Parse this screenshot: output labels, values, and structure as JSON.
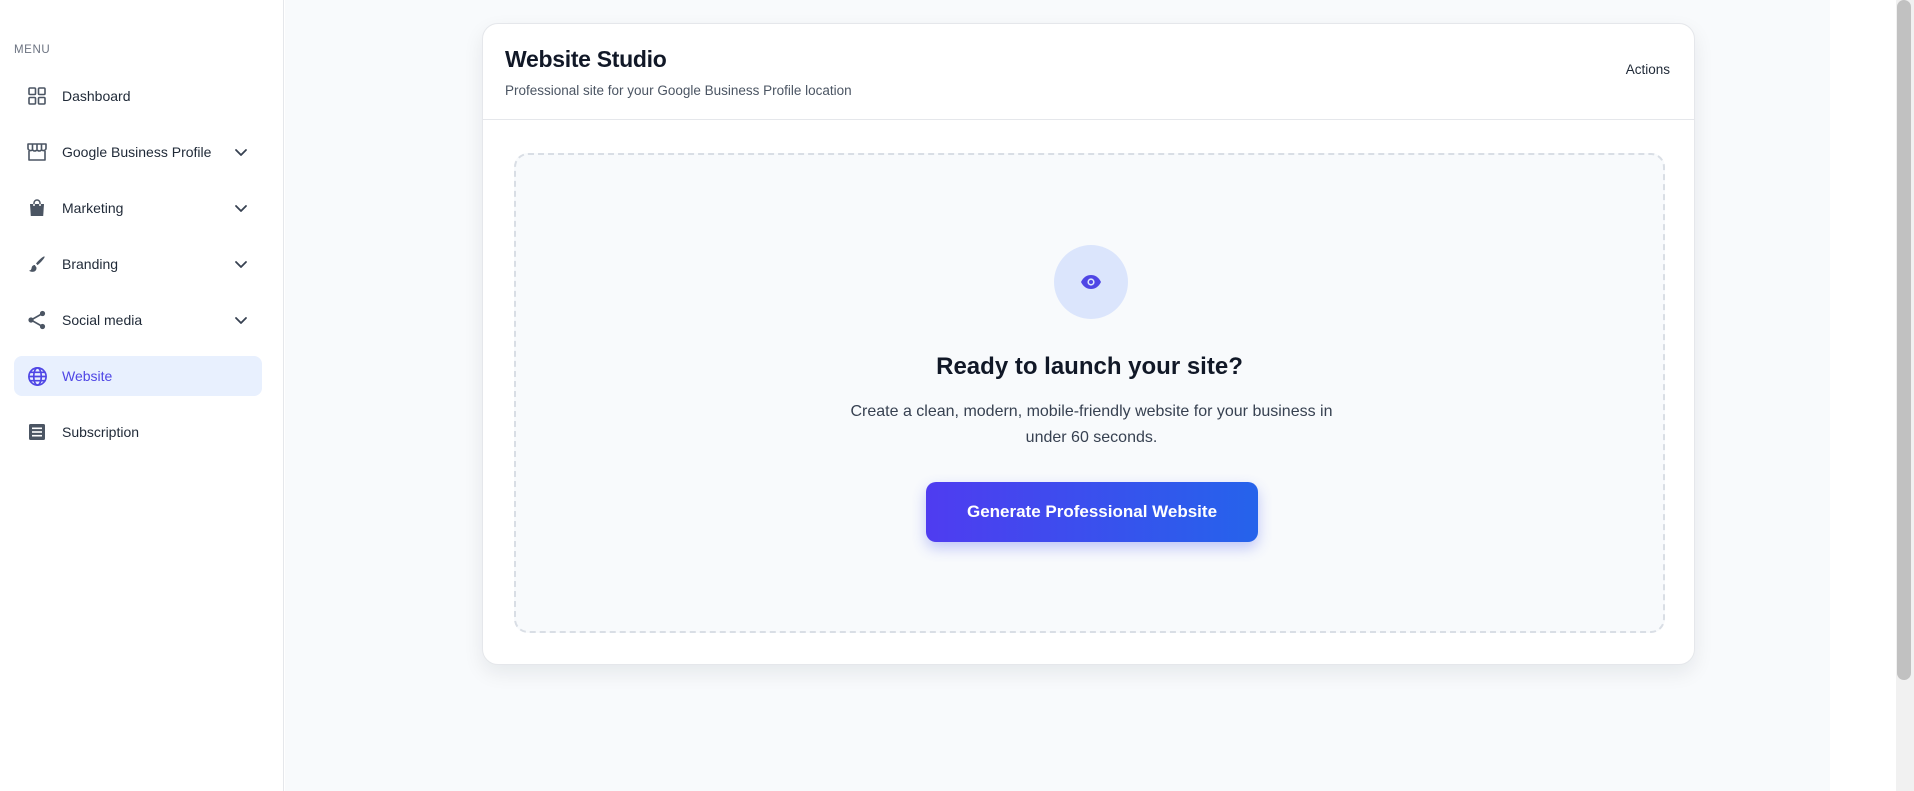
{
  "sidebar": {
    "menu_label": "MENU",
    "items": [
      {
        "label": "Dashboard",
        "icon": "dashboard-grid-icon",
        "has_chevron": false,
        "active": false
      },
      {
        "label": "Google Business Profile",
        "icon": "storefront-icon",
        "has_chevron": true,
        "active": false
      },
      {
        "label": "Marketing",
        "icon": "shopping-bag-icon",
        "has_chevron": true,
        "active": false
      },
      {
        "label": "Branding",
        "icon": "brush-icon",
        "has_chevron": true,
        "active": false
      },
      {
        "label": "Social media",
        "icon": "share-icon",
        "has_chevron": true,
        "active": false
      },
      {
        "label": "Website",
        "icon": "globe-icon",
        "has_chevron": false,
        "active": true
      },
      {
        "label": "Subscription",
        "icon": "subscription-list-icon",
        "has_chevron": false,
        "active": false
      }
    ]
  },
  "card": {
    "title": "Website Studio",
    "subtitle": "Professional site for your Google Business Profile location",
    "actions_label": "Actions"
  },
  "empty_state": {
    "icon": "eye-icon",
    "title": "Ready to launch your site?",
    "description": "Create a clean, modern, mobile-friendly website for your business in under 60 seconds.",
    "button_label": "Generate Professional Website"
  },
  "colors": {
    "accent": "#4f46e5",
    "active_bg": "#e8f0fe",
    "button_gradient_start": "#4f3cf0",
    "button_gradient_end": "#2563eb",
    "icon_circle": "#dbe5fc"
  }
}
